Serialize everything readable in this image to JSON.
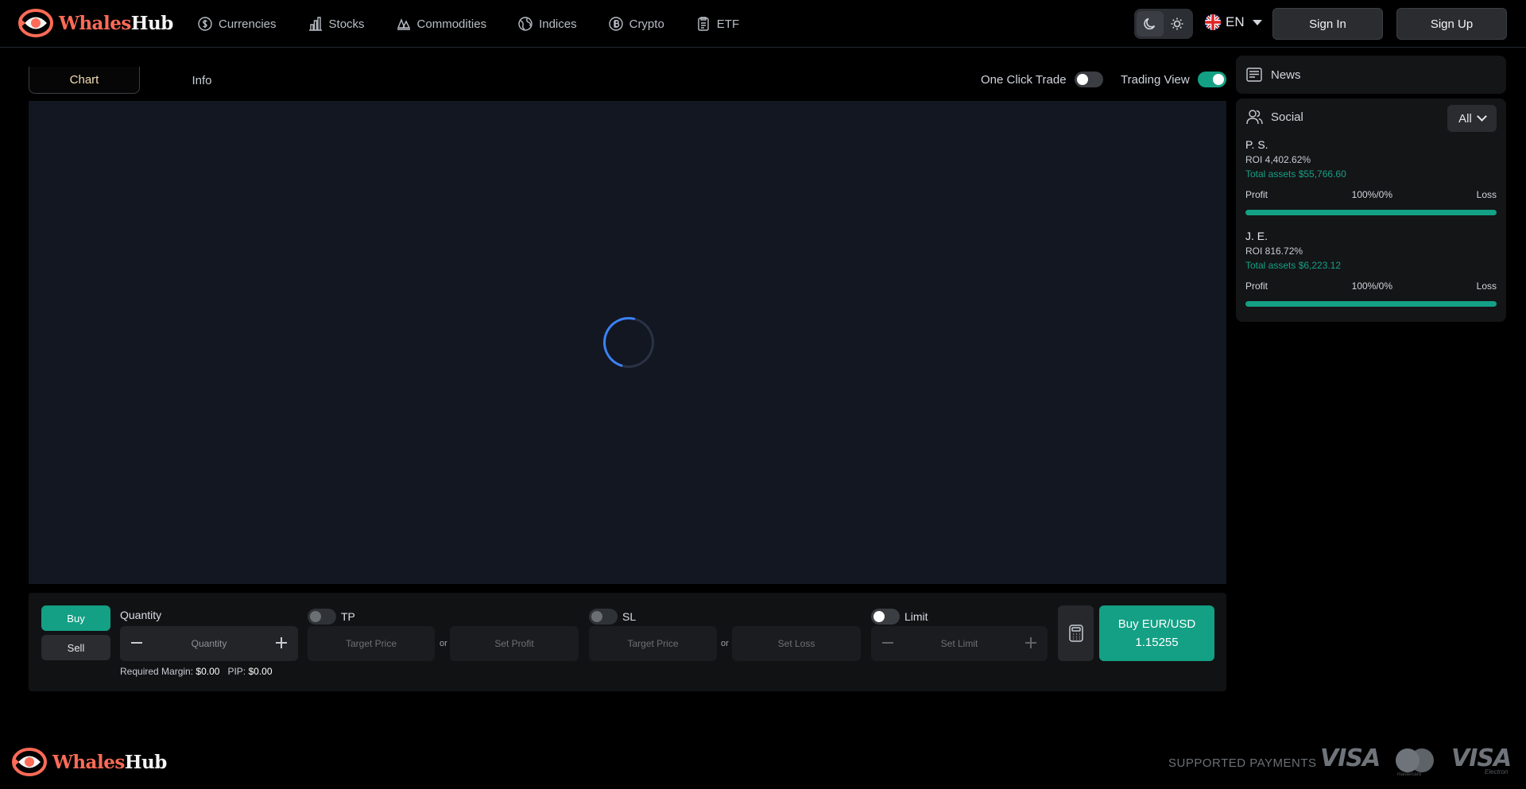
{
  "header": {
    "brand": {
      "part1": "Whales",
      "part2": "Hub"
    },
    "nav": [
      {
        "label": "Currencies",
        "icon": "dollar-coin-icon"
      },
      {
        "label": "Stocks",
        "icon": "bar-chart-icon"
      },
      {
        "label": "Commodities",
        "icon": "commodities-icon"
      },
      {
        "label": "Indices",
        "icon": "globe-icon"
      },
      {
        "label": "Crypto",
        "icon": "bitcoin-icon"
      },
      {
        "label": "ETF",
        "icon": "clipboard-icon"
      }
    ],
    "theme": {
      "active": "dark",
      "icons": [
        "moon-icon",
        "sun-icon"
      ]
    },
    "language": "EN",
    "sign_in": "Sign In",
    "sign_up": "Sign Up"
  },
  "tabs": {
    "chart": "Chart",
    "info": "Info",
    "active": "Chart"
  },
  "toggles": {
    "one_click_trade": {
      "label": "One Click Trade",
      "on": false
    },
    "trading_view": {
      "label": "Trading View",
      "on": true
    }
  },
  "trade_panel": {
    "buy": "Buy",
    "sell": "Sell",
    "quantity_label": "Quantity",
    "quantity_placeholder": "Quantity",
    "tp_label": "TP",
    "tp_target_placeholder": "Target Price",
    "tp_profit_placeholder": "Set Profit",
    "sl_label": "SL",
    "sl_target_placeholder": "Target Price",
    "sl_loss_placeholder": "Set Loss",
    "or": "or",
    "limit_label": "Limit",
    "limit_placeholder": "Set Limit",
    "required_margin_label": "Required Margin:",
    "required_margin_value": "$0.00",
    "pip_label": "PIP:",
    "pip_value": "$0.00",
    "buy_button_line1": "Buy EUR/USD",
    "buy_button_line2": "1.15255"
  },
  "sidebar": {
    "news": "News",
    "social": "Social",
    "filter": "All",
    "traders": [
      {
        "name": "P. S.",
        "roi": "ROI 4,402.62%",
        "assets": "Total assets $55,766.60",
        "profit": "Profit",
        "ratio": "100%/0%",
        "loss": "Loss",
        "profit_fraction": 1.0
      },
      {
        "name": "J. E.",
        "roi": "ROI 816.72%",
        "assets": "Total assets $6,223.12",
        "profit": "Profit",
        "ratio": "100%/0%",
        "loss": "Loss",
        "profit_fraction": 1.0
      }
    ]
  },
  "footer": {
    "brand": {
      "part1": "Whales",
      "part2": "Hub"
    },
    "supported_payments": "SUPPORTED PAYMENTS",
    "payments": [
      "VISA",
      "mastercard",
      "VISA Electron"
    ],
    "payment_texts": {
      "visa": "VISA",
      "mastercard": "mastercard",
      "visa_electron": "VISA",
      "electron": "Electron"
    }
  },
  "colors": {
    "accent": "#14a085",
    "brand": "#ff6b57",
    "background": "#000000",
    "panel": "#141517",
    "chart_bg": "#131722"
  }
}
